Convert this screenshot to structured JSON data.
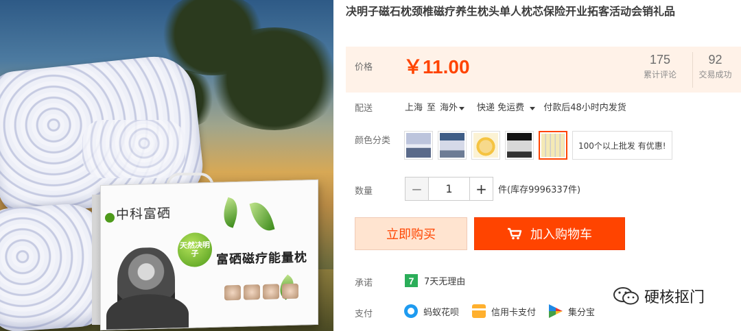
{
  "product": {
    "title": "决明子磁石枕颈椎磁疗养生枕头单人枕芯保险开业拓客活动会销礼品",
    "image": {
      "box_brand": "中科富硒",
      "box_title": "富硒磁疗能量枕",
      "badge": "天然决明子"
    }
  },
  "price": {
    "label": "价格",
    "value": "￥11.00",
    "reviews_count": "175",
    "reviews_label": "累计评论",
    "sales_count": "92",
    "sales_label": "交易成功"
  },
  "delivery": {
    "label": "配送",
    "from": "上海",
    "to_word": "至",
    "destination": "海外",
    "method": "快递 免运费",
    "ship_time": "付款后48小时内发货"
  },
  "color": {
    "label": "颜色分类",
    "options": [
      {
        "name": "option-1",
        "selected": false
      },
      {
        "name": "option-2",
        "selected": false
      },
      {
        "name": "option-3",
        "selected": false
      },
      {
        "name": "option-4",
        "selected": false
      },
      {
        "name": "option-5",
        "selected": true
      }
    ],
    "text_option": "100个以上批发 有优惠!"
  },
  "quantity": {
    "label": "数量",
    "minus": "−",
    "value": "1",
    "plus": "+",
    "stock": "件(库存9996337件)"
  },
  "actions": {
    "buy_now": "立即购买",
    "add_to_cart": "加入购物车"
  },
  "promise": {
    "label": "承诺",
    "icon_text": "7",
    "text": "7天无理由"
  },
  "payment": {
    "label": "支付",
    "methods": [
      "蚂蚁花呗",
      "信用卡支付",
      "集分宝"
    ]
  },
  "watermark": "硬核抠门",
  "colors": {
    "accent": "#ff4400",
    "price_bg": "#fff2e8",
    "buy_bg": "#ffe4d0",
    "promise_green": "#2bae59"
  },
  "icons": [
    "cart-icon",
    "seven-day-icon",
    "huabei-icon",
    "credit-card-icon",
    "jifenbao-icon",
    "wechat-icon",
    "caret-down-icon"
  ]
}
